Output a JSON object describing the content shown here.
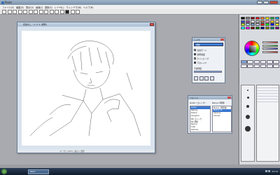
{
  "app": {
    "title": "Paint"
  },
  "menu": {
    "items": [
      "ファイル(F)",
      "編集(E)",
      "表示(V)",
      "画像(I)",
      "選択(S)",
      "レイヤ(L)",
      "ウィンドウ(W)",
      "ヘルプ(H)"
    ]
  },
  "canvas_window": {
    "title": "名前なし - 2 | 1:1 (標準)",
    "status": "ユーザ | 100% | 縮小 | 選択"
  },
  "layer_panel": {
    "title": "レイヤ",
    "selected_layer": "通常",
    "options": [
      "合成モード",
      "透明保護",
      "クリッピング",
      "下のレイヤ"
    ],
    "opacity_label": "不透明度",
    "opacity_value": 100
  },
  "font_panel": {
    "title": "フォント",
    "left_header": "Gulim (ゴシック)",
    "right_header": "Meiryo (明朝)",
    "fonts_left": [
      "Gulim",
      "Batang",
      "Dotum",
      "Gungsuh",
      "MS ゴシック",
      "MS 明朝",
      "Meiryo",
      "Arial",
      "Tahoma"
    ],
    "fonts_right": [
      "Meiryo (明朝体)",
      "Meiryo UI",
      "Century",
      "Courier"
    ],
    "selected_left": 0,
    "selected_right": 1
  },
  "palette": {
    "colors": [
      "#000000",
      "#7f7f7f",
      "#880015",
      "#ed1c24",
      "#ff7f27",
      "#fff200",
      "#22b14c",
      "#00a2e8",
      "#3f48cc",
      "#a349a4",
      "#ffffff",
      "#c3c3c3",
      "#b97a57",
      "#ffaec9",
      "#ffc90e",
      "#efe4b0",
      "#b5e61d",
      "#99d9ea",
      "#7092be",
      "#c8bfe7",
      "#ff0000",
      "#00ff00",
      "#0000ff",
      "#ffff00",
      "#00ffff",
      "#ff00ff",
      "#800000",
      "#008000",
      "#000080",
      "#808000",
      "#008080",
      "#800080"
    ]
  },
  "taskbar": {
    "task_label": "Paint",
    "clock": "23:14"
  }
}
